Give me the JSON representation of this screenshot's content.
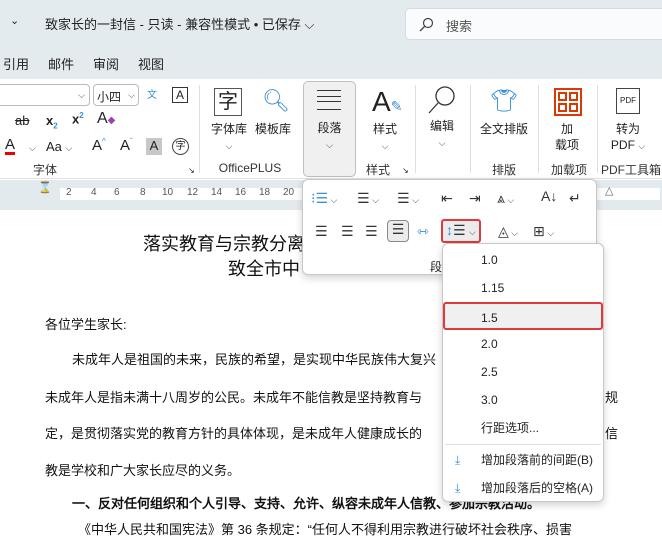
{
  "titlebar": {
    "qat_more": "⌄",
    "title": "致家长的一封信 - 只读 - 兼容性模式 • 已保存 ⌵",
    "search_placeholder": "搜索"
  },
  "tabs": [
    "引用",
    "邮件",
    "审阅",
    "视图"
  ],
  "ribbon": {
    "font": {
      "font_size": "小四",
      "label": "字体",
      "case_label": "Aa"
    },
    "officeplus": {
      "font_lib": "字体库",
      "template_lib": "模板库",
      "label": "OfficePLUS"
    },
    "paragraph": {
      "button": "段落"
    },
    "styles": {
      "button": "样式",
      "label": "样式"
    },
    "editing": {
      "button": "编辑"
    },
    "layout": {
      "button": "全文排版",
      "label": "排版"
    },
    "addins": {
      "button": "加\n载项",
      "label": "加载项"
    },
    "pdf": {
      "button": "转为",
      "button2": "PDF",
      "label": "PDF工具箱"
    }
  },
  "ruler": [
    "2",
    "4",
    "6",
    "8",
    "10",
    "12",
    "14",
    "16",
    "18",
    "20"
  ],
  "paragraph_popup": {
    "label": "段落"
  },
  "line_spacing_menu": {
    "options": [
      "1.0",
      "1.15",
      "1.5",
      "2.0",
      "2.5",
      "3.0"
    ],
    "selected": "1.5",
    "more": "行距选项...",
    "add_before": "增加段落前的间距(B)",
    "add_after": "增加段落后的空格(A)"
  },
  "document": {
    "title1": "落实教育与宗教分离",
    "title2": "致全市中",
    "greeting": "各位学生家长:",
    "p1": "未成年人是祖国的未来，民族的希望，是实现中华民族伟大复兴",
    "p2": "未成年人是指未满十八周岁的公民。未成年不能信教是坚持教育与",
    "p2_end": "规",
    "p3": "定，是贯彻落实党的教育方针的具体体现，是未成年人健康成长的",
    "p3_end": "信",
    "p4": "教是学校和广大家长应尽的义务。",
    "h1": "一、反对任何组织和个人引导、支持、允许、纵容未成年人信教、参加宗教活动。",
    "p5": "《中华人民共和国宪法》第 36 条规定：“任何人不得利用宗教进行破坏社会秩序、损害"
  }
}
